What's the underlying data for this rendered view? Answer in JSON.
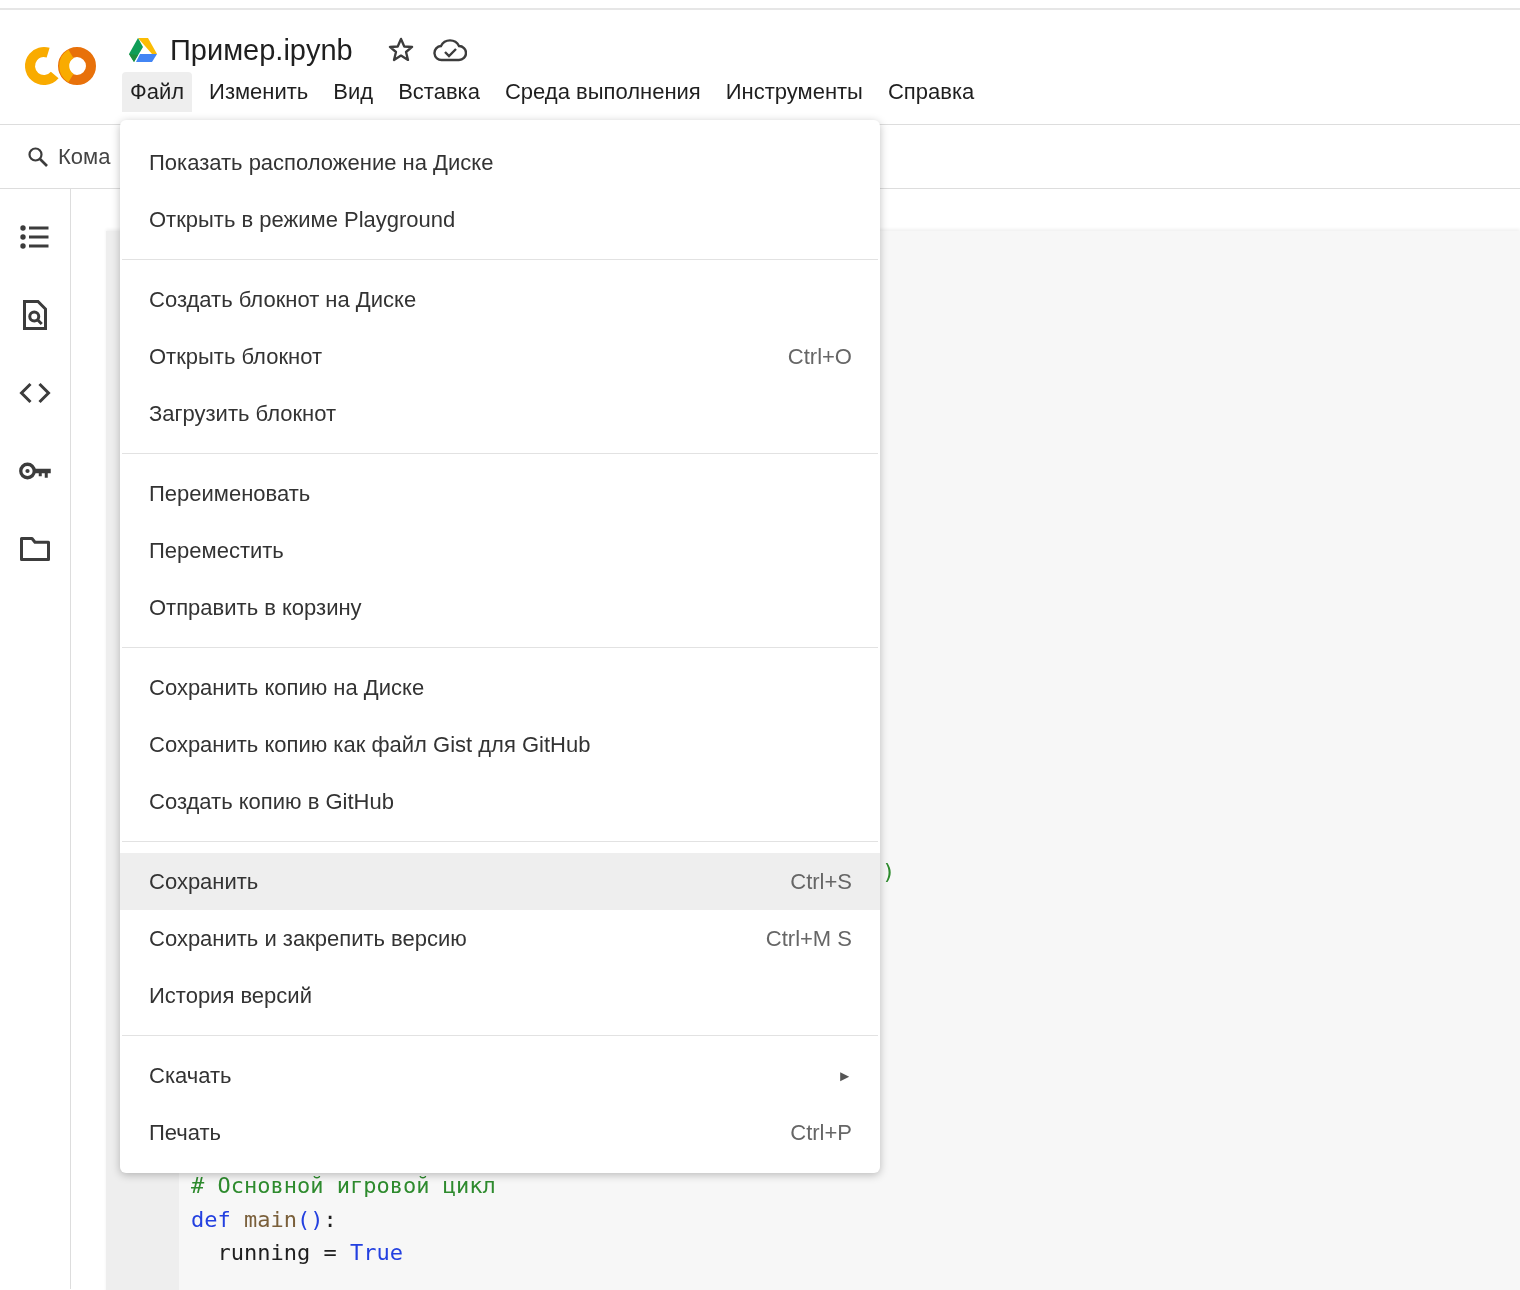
{
  "notebook": {
    "title": "Пример.ipynb"
  },
  "menubar": [
    {
      "label": "Файл",
      "selected": true
    },
    {
      "label": "Изменить",
      "selected": false
    },
    {
      "label": "Вид",
      "selected": false
    },
    {
      "label": "Вставка",
      "selected": false
    },
    {
      "label": "Среда выполнения",
      "selected": false
    },
    {
      "label": "Инструменты",
      "selected": false
    },
    {
      "label": "Справка",
      "selected": false
    }
  ],
  "command_search": {
    "placeholder": "Кома"
  },
  "code_cell": {
    "hidden_line_tail": ")",
    "lines": [
      {
        "kind": "comment",
        "text": "# Основной игровой цикл"
      },
      {
        "kind": "def",
        "keyword": "def",
        "name": "main",
        "parens": "()",
        "colon": ":"
      },
      {
        "kind": "assign",
        "name": "running",
        "op": "=",
        "value": "True"
      }
    ]
  },
  "file_menu": {
    "groups": [
      [
        {
          "label": "Показать расположение на Диске",
          "highlighted": false
        },
        {
          "label": "Открыть в режиме Playground",
          "highlighted": false
        }
      ],
      [
        {
          "label": "Создать блокнот на Диске",
          "highlighted": false
        },
        {
          "label": "Открыть блокнот",
          "shortcut": "Ctrl+O",
          "highlighted": false
        },
        {
          "label": "Загрузить блокнот",
          "highlighted": false
        }
      ],
      [
        {
          "label": "Переименовать",
          "highlighted": false
        },
        {
          "label": "Переместить",
          "highlighted": false
        },
        {
          "label": "Отправить в корзину",
          "highlighted": false
        }
      ],
      [
        {
          "label": "Сохранить копию на Диске",
          "highlighted": false
        },
        {
          "label": "Сохранить копию как файл Gist для GitHub",
          "highlighted": false
        },
        {
          "label": "Создать копию в GitHub",
          "highlighted": false
        }
      ],
      [
        {
          "label": "Сохранить",
          "shortcut": "Ctrl+S",
          "highlighted": true
        },
        {
          "label": "Сохранить и закрепить версию",
          "shortcut": "Ctrl+M S",
          "highlighted": false
        },
        {
          "label": "История версий",
          "highlighted": false
        }
      ],
      [
        {
          "label": "Скачать",
          "submenu_arrow": "►",
          "highlighted": false
        },
        {
          "label": "Печать",
          "shortcut": "Ctrl+P",
          "highlighted": false
        }
      ]
    ]
  }
}
